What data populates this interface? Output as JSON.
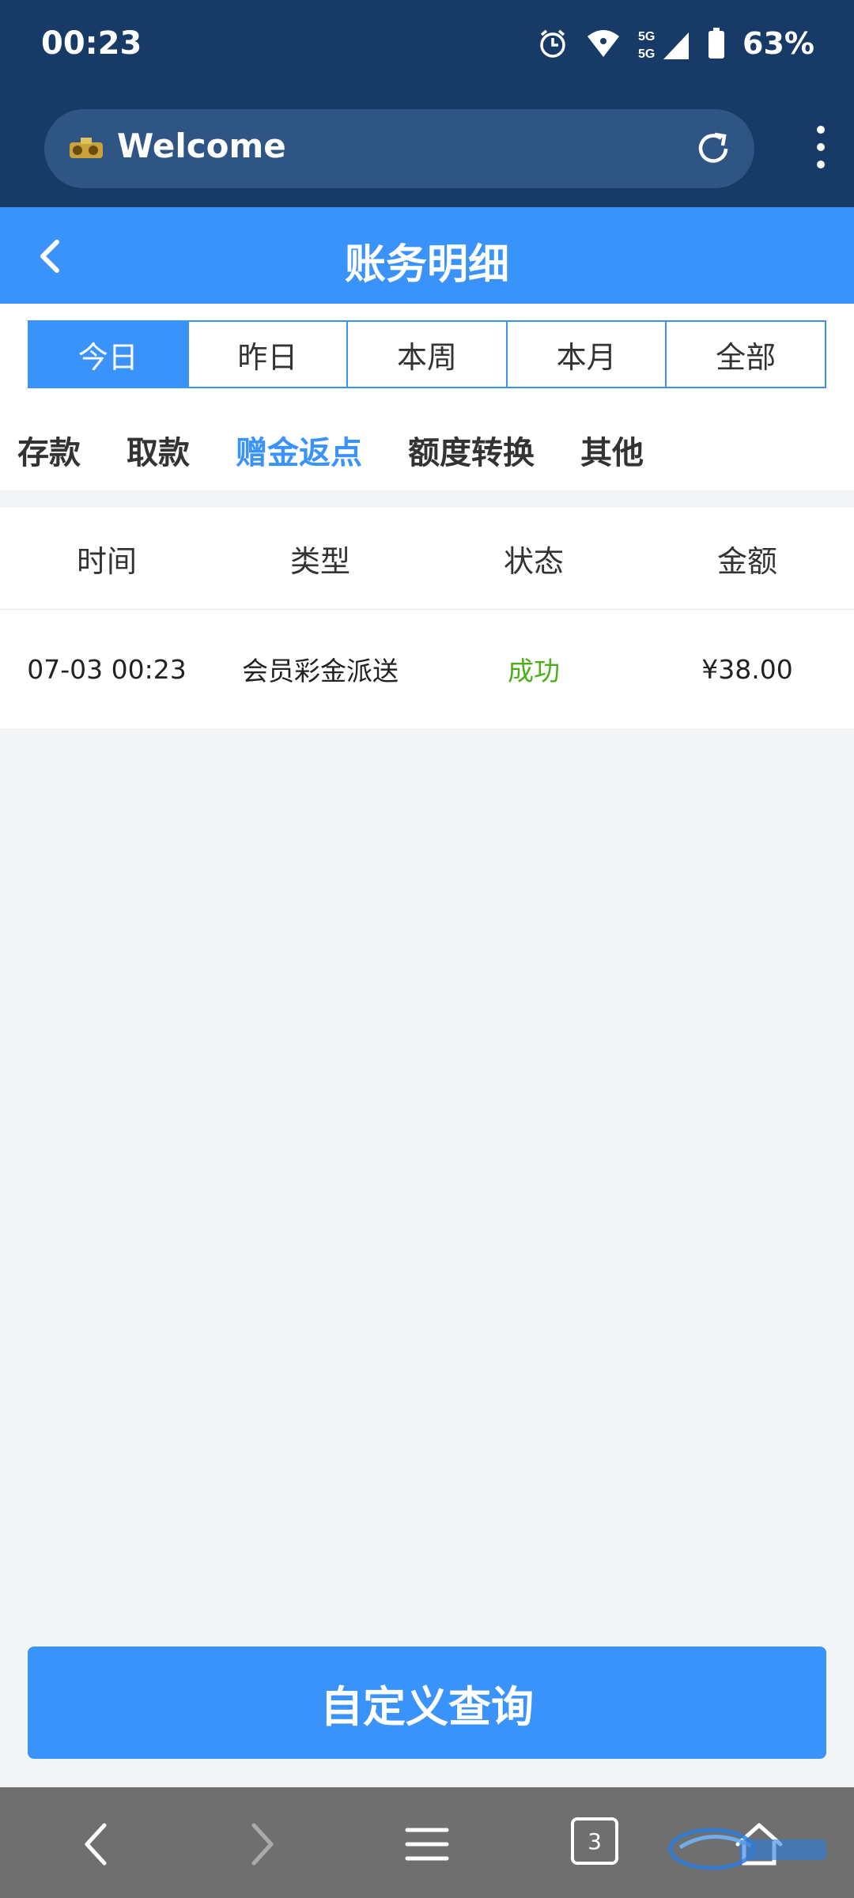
{
  "status_bar": {
    "time": "00:23",
    "network": "5G",
    "battery": "63%",
    "icons": [
      "alarm-icon",
      "wifi-icon",
      "signal-icon",
      "battery-icon"
    ]
  },
  "browser": {
    "page_title": "Welcome",
    "icons": [
      "site-favicon",
      "reload-icon",
      "more-menu-icon"
    ]
  },
  "header": {
    "title": "账务明细",
    "back_icon": "chevron-left-icon"
  },
  "period_tabs": [
    {
      "label": "今日",
      "active": true
    },
    {
      "label": "昨日",
      "active": false
    },
    {
      "label": "本周",
      "active": false
    },
    {
      "label": "本月",
      "active": false
    },
    {
      "label": "全部",
      "active": false
    }
  ],
  "type_tabs": [
    {
      "label": "存款",
      "active": false
    },
    {
      "label": "取款",
      "active": false
    },
    {
      "label": "赠金返点",
      "active": true
    },
    {
      "label": "额度转换",
      "active": false
    },
    {
      "label": "其他",
      "active": false
    }
  ],
  "table": {
    "columns": [
      "时间",
      "类型",
      "状态",
      "金额"
    ],
    "rows": [
      {
        "time": "07-03 00:23",
        "type": "会员彩金派送",
        "status": "成功",
        "amount": "¥38.00"
      }
    ]
  },
  "query_button": {
    "label": "自定义查询"
  },
  "bottom_nav": {
    "tab_count": "3",
    "icons": [
      "back-icon",
      "forward-icon",
      "menu-icon",
      "tabs-icon",
      "home-icon"
    ]
  },
  "colors": {
    "primary": "#3a93fb",
    "statusbar_bg": "#173a66",
    "success": "#4caf1a",
    "navbar_bg": "#6f6f6f"
  }
}
